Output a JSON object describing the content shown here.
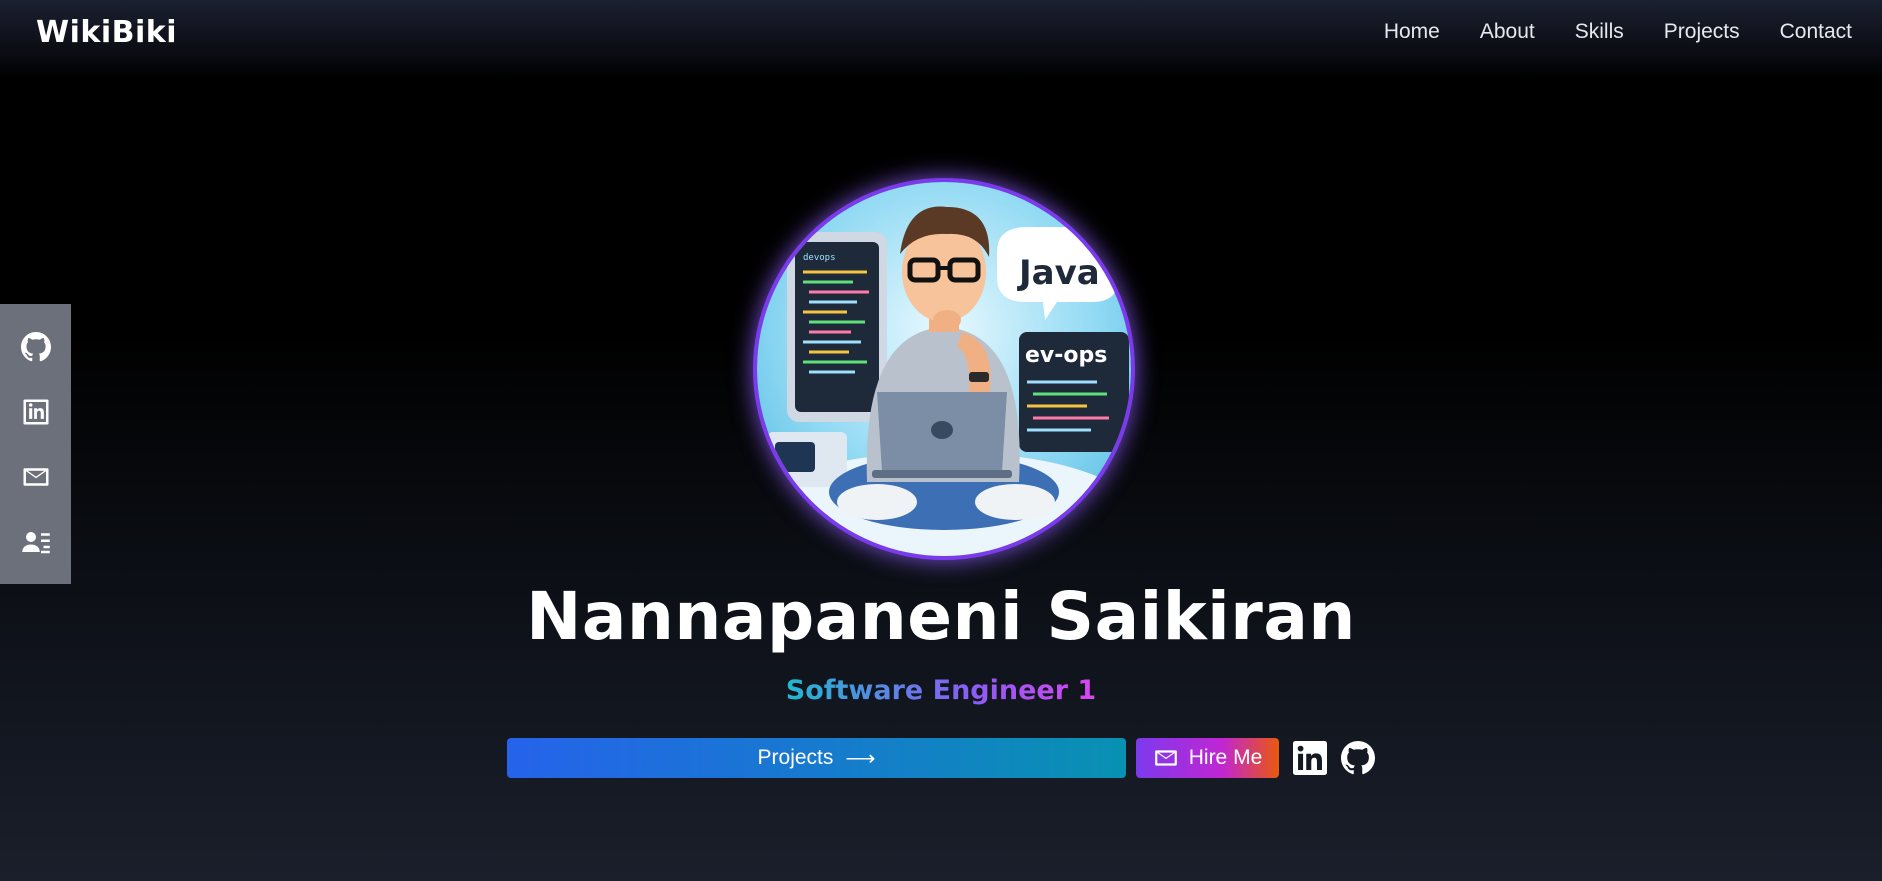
{
  "header": {
    "brand": "WikiBiki",
    "nav": [
      {
        "label": "Home"
      },
      {
        "label": "About"
      },
      {
        "label": "Skills"
      },
      {
        "label": "Projects"
      },
      {
        "label": "Contact"
      }
    ]
  },
  "side_dock": {
    "items": [
      {
        "icon": "github-icon"
      },
      {
        "icon": "linkedin-icon"
      },
      {
        "icon": "mail-icon"
      },
      {
        "icon": "contact-card-icon"
      }
    ]
  },
  "hero": {
    "avatar": {
      "bubble_text": "Java",
      "screen_text": "ev-ops",
      "left_screen_text": "devops"
    },
    "name": "Nannapaneni Saikiran",
    "role": "Software Engineer 1",
    "projects_button": "Projects",
    "projects_arrow": "⟶",
    "hire_button": "Hire Me"
  },
  "colors": {
    "projects_gradient": [
      "#2563eb",
      "#0891b2"
    ],
    "hire_gradient": [
      "#7c3aed",
      "#c026d3",
      "#ea580c"
    ],
    "role_gradient": [
      "#22b8cf",
      "#8b5cf6",
      "#d946ef"
    ],
    "avatar_glow": "#8b5cf6",
    "dock_bg": "#6b707b"
  }
}
